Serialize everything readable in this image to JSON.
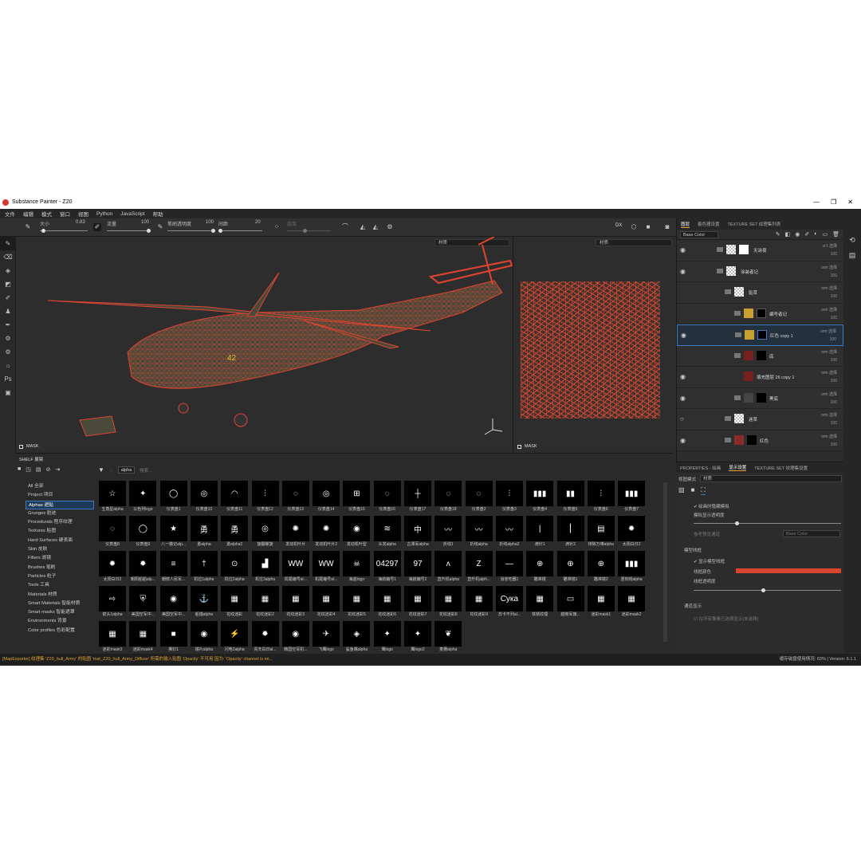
{
  "window": {
    "title": "Substance Painter - Z20",
    "minimize": "—",
    "restore": "❐",
    "close": "✕"
  },
  "menu": [
    "文件",
    "编辑",
    "模式",
    "窗口",
    "视图",
    "Python",
    "JavaScript",
    "帮助"
  ],
  "toolbar": {
    "size_label": "大小",
    "size_value": "0.83",
    "flow_label": "流量",
    "flow_value": "100",
    "stroke_opacity_label": "笔刷透明度",
    "stroke_opacity_value": "100",
    "spacing_label": "间距",
    "spacing_value": "20",
    "angle_label": "旋度",
    "dx_label": "DX"
  },
  "viewports": {
    "left_dropdown": "材质",
    "right_dropdown": "材质",
    "mask_label": "MASK"
  },
  "layers": {
    "tabs": [
      "图层",
      "着色器设置",
      "TEXTURE SET 纹理集列表"
    ],
    "channel": "Base Color",
    "rows": [
      {
        "name": "无涂夜",
        "blend": "vr1 选择",
        "opacity": "100"
      },
      {
        "name": "涂装者记",
        "blend": "orm 选择",
        "opacity": "100"
      },
      {
        "name": "贴草",
        "blend": "orm 选择",
        "opacity": "100"
      },
      {
        "name": "编号者记",
        "blend": "orm 选择",
        "opacity": "100"
      },
      {
        "name": "红色 copy 1",
        "blend": "orm 选择",
        "opacity": "100"
      },
      {
        "name": "底",
        "blend": "orm 选择",
        "opacity": "100"
      },
      {
        "name": "填充图层 26 copy 1",
        "blend": "orm 选择",
        "opacity": "100"
      },
      {
        "name": "黑底",
        "blend": "orm 选择",
        "opacity": "100"
      },
      {
        "name": "迷草",
        "blend": "orm 选择",
        "opacity": "100"
      },
      {
        "name": "红色",
        "blend": "orm 选择",
        "opacity": "100"
      }
    ]
  },
  "properties": {
    "tabs": [
      "PROPERTIES - 绘画",
      "显示设置",
      "TEXTURE SET 纹理集设置"
    ],
    "view_mode_label": "视图模式",
    "view_mode_value": "材质",
    "cb_hide_bg": "绘画时隐藏模拟",
    "model_opacity_label": "模拟显示透明度",
    "base_channel_label": "参考预览通道",
    "base_channel_value": "Base Color",
    "wire_section": "模型线框",
    "cb_show_wire": "显示模型线框",
    "wire_color_label": "线框颜色",
    "wire_opacity_label": "线框透明度",
    "wire_color": "#d9452f",
    "channel_section": "通道显示",
    "cb_channel": "在所有像素已选择显示(未选择)"
  },
  "shelf": {
    "title": "SHELF 展架",
    "search_tag": "alpha",
    "search_placeholder": "搜索...",
    "categories": [
      "All 全部",
      "Project 项目",
      "Alphas 遮贴",
      "Grunges 脏迹",
      "Procedurals 程序纹理",
      "Textures 贴图",
      "Hard Surfaces 硬表面",
      "Skin 皮肤",
      "Filters 滤镜",
      "Brushes 笔刷",
      "Particles 粒子",
      "Tools 工具",
      "Materials 材质",
      "Smart Materials 智能材质",
      "Smart masks 智能遮罩",
      "Environments 背景",
      "Color profiles 色彩配置"
    ],
    "active_category": 2,
    "items": [
      [
        "五角星alpha",
        "☆"
      ],
      [
        "以色列logo",
        "✦"
      ],
      [
        "仪表盘1",
        "◯"
      ],
      [
        "仪表盘10",
        "◎"
      ],
      [
        "仪表盘11",
        "◠"
      ],
      [
        "仪表盘12",
        "⫶"
      ],
      [
        "仪表盘13",
        "◌"
      ],
      [
        "仪表盘14",
        "◎"
      ],
      [
        "仪表盘15",
        "⊞"
      ],
      [
        "仪表盘16",
        "◌"
      ],
      [
        "仪表盘17",
        "┼"
      ],
      [
        "仪表盘18",
        "◌"
      ],
      [
        "仪表盘2",
        "◌"
      ],
      [
        "仪表盘3",
        "⫶"
      ],
      [
        "仪表盘4",
        "▮▮▮"
      ],
      [
        "仪表盘5",
        "▮▮"
      ],
      [
        "仪表盘6",
        "⫶"
      ],
      [
        "仪表盘7",
        "▮▮▮"
      ],
      [
        "仪表盘8",
        "◌"
      ],
      [
        "仪表盘9",
        "◯"
      ],
      [
        "八一徽记alp...",
        "★"
      ],
      [
        "勇alpha",
        "勇"
      ],
      [
        "勇alpha2",
        "勇"
      ],
      [
        "旋翻螺旋",
        "◎"
      ],
      [
        "发动机叶片",
        "✺"
      ],
      [
        "发动机叶片2",
        "✺"
      ],
      [
        "发动机叶型",
        "◉"
      ],
      [
        "头发alpha",
        "≋"
      ],
      [
        "古潭军alpha",
        "中"
      ],
      [
        "折线1",
        "〰"
      ],
      [
        "折线alpha",
        "〰"
      ],
      [
        "折线alpha2",
        "〰"
      ],
      [
        "滴针1",
        "|"
      ],
      [
        "滴针2",
        "⎮"
      ],
      [
        "排除万难alpha",
        "▤"
      ],
      [
        "太阳白日2",
        "✹"
      ],
      [
        "太阳白日2",
        "✹"
      ],
      [
        "朝阳船舶alp...",
        "✹"
      ],
      [
        "朝鲜人民军...",
        "≡"
      ],
      [
        "机位1alpha",
        "†"
      ],
      [
        "机位2alpha",
        "⊙"
      ],
      [
        "机位3alpha",
        "▟"
      ],
      [
        "机尾编号al...",
        "WW"
      ],
      [
        "机尾编号al...",
        "WW"
      ],
      [
        "海盗logo",
        "☠"
      ],
      [
        "海航编号1",
        "04297"
      ],
      [
        "海航编号2",
        "97"
      ],
      [
        "直升机alpha",
        "ʌ"
      ],
      [
        "直升机alph...",
        "Z"
      ],
      [
        "消雀吃器1",
        "—"
      ],
      [
        "瞄准镜",
        "⊕"
      ],
      [
        "瞄准镜1",
        "⊕"
      ],
      [
        "瞄准镜2",
        "⊕"
      ],
      [
        "竖刻线alpha",
        "▮▮▮"
      ],
      [
        "箭头1alpha",
        "⇨"
      ],
      [
        "美国空军中...",
        "⛨"
      ],
      [
        "美国空军中...",
        "◉"
      ],
      [
        "船锚alpha",
        "⚓"
      ],
      [
        "花纹迷彩",
        "▦"
      ],
      [
        "花纹迷彩2",
        "▦"
      ],
      [
        "花纹迷彩3",
        "▦"
      ],
      [
        "花纹迷彩4",
        "▦"
      ],
      [
        "花纹迷彩5",
        "▦"
      ],
      [
        "花纹迷彩6",
        "▦"
      ],
      [
        "花纹迷彩7",
        "▦"
      ],
      [
        "花纹迷彩8",
        "▦"
      ],
      [
        "花纹迷彩9",
        "▦"
      ],
      [
        "苏卡不列al...",
        "Сука"
      ],
      [
        "铁锈纹理",
        "▦"
      ],
      [
        "越南军旗...",
        "▭"
      ],
      [
        "迷彩mask1",
        "▦"
      ],
      [
        "迷彩mask2",
        "▦"
      ],
      [
        "迷彩mask3",
        "▦"
      ],
      [
        "迷彩mask4",
        "▦"
      ],
      [
        "撕钉1",
        "■"
      ],
      [
        "镜片alpha",
        "◉"
      ],
      [
        "闪电2alpha",
        "⚡"
      ],
      [
        "青天白日al...",
        "✹"
      ],
      [
        "韩国空军机...",
        "◉"
      ],
      [
        "飞鹰logo",
        "✈"
      ],
      [
        "鲨鱼嘴alpha",
        "◈"
      ],
      [
        "鹰logo",
        "✦"
      ],
      [
        "鹰logo2",
        "✦"
      ],
      [
        "麦穗alpha",
        "❦"
      ]
    ]
  },
  "status": {
    "log": "[MapExporter] 纹理集 'Z20_hull_Army' 的贴图 'mat_Z20_hull_Army_Diffuse' 所需的输入贴图 'Opacity' 不可用 因为: 'Opacity' channel is mi...",
    "cache_label": "缓存磁盘使用情况:",
    "cache_value": "63%",
    "version": "Version: 6.1.1"
  }
}
